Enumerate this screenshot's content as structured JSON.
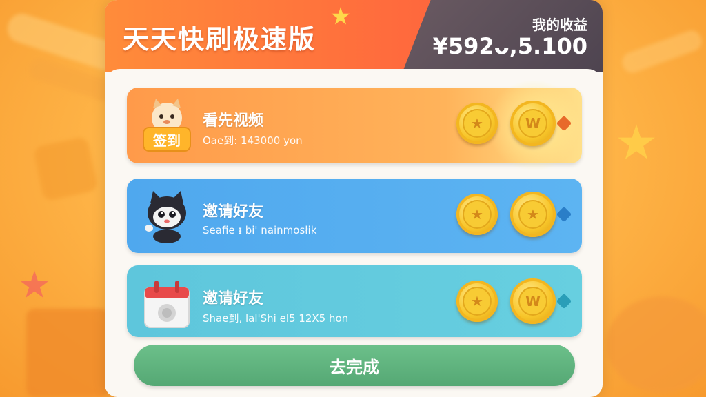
{
  "header": {
    "app_title": "天天快刷极速版",
    "earnings_label": "我的收益",
    "earnings_value": "¥592ᴗ,5.100"
  },
  "tasks": [
    {
      "title": "看先视频",
      "subtitle": "Oaе到: 143000 yon",
      "badge": "签到",
      "icon": "mascot-sign-in-icon",
      "coins": [
        "star-coin-icon",
        "w-coin-icon"
      ]
    },
    {
      "title": "邀请好友",
      "subtitle": "Seafie ᵻ bi' nainmosłik",
      "icon": "mascot-cat-icon",
      "coins": [
        "star-coin-icon",
        "star-coin-icon"
      ]
    },
    {
      "title": "邀请好友",
      "subtitle": "Shae到, lal'Shi el5 12X5 hon",
      "icon": "calendar-icon",
      "coins": [
        "star-coin-icon",
        "w-coin-icon"
      ]
    }
  ],
  "action": {
    "label": "去完成"
  },
  "colors": {
    "header": "#ff6a3d",
    "card1": "#ff9a4a",
    "card2": "#4fa8ee",
    "card3": "#5ec6dc",
    "action": "#5ab47c",
    "coin": "#f8c62a"
  }
}
